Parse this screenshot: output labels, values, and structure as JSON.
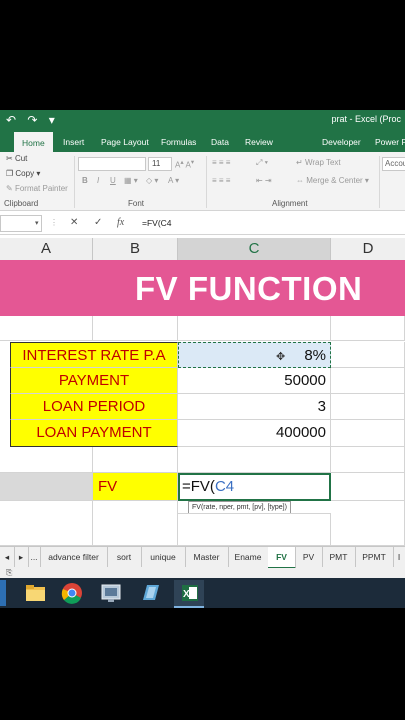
{
  "titlebar": {
    "quick_access": "↶ ↷ ▾",
    "window_title": "prat - Excel (Proc"
  },
  "tabs": [
    {
      "label": "Home",
      "active": true
    },
    {
      "label": "Insert"
    },
    {
      "label": "Page Layout"
    },
    {
      "label": "Formulas"
    },
    {
      "label": "Data"
    },
    {
      "label": "Review"
    },
    {
      "label": "Developer"
    },
    {
      "label": "Power Pi"
    }
  ],
  "ribbon": {
    "cut": "Cut",
    "copy": "Copy",
    "format_painter": "Format Painter",
    "clipboard_group": "Clipboard",
    "font_size": "11",
    "bold": "B",
    "italic": "I",
    "underline": "U",
    "font_group": "Font",
    "wrap_text": "Wrap Text",
    "merge_center": "Merge & Center",
    "alignment_group": "Alignment",
    "number_format": "Accou"
  },
  "formula_bar": {
    "cancel": "✕",
    "enter": "✓",
    "fx": "fx",
    "formula": "=FV(C4"
  },
  "columns": [
    "A",
    "B",
    "C",
    "D"
  ],
  "sheet": {
    "banner": "FV FUNCTION",
    "rows": [
      {
        "label": "INTEREST RATE P.A",
        "value": "8%"
      },
      {
        "label": "PAYMENT",
        "value": "50000"
      },
      {
        "label": "LOAN PERIOD",
        "value": "3"
      },
      {
        "label": "LOAN PAYMENT",
        "value": "400000"
      }
    ],
    "fv_label": "FV",
    "fv_formula_prefix": "=FV(",
    "fv_formula_ref": "C4",
    "tooltip": "FV(rate, nper, pmt, [pv], [type])"
  },
  "sheet_tabs": {
    "ellipsis": "...",
    "tabs": [
      "advance filter",
      "sort",
      "unique",
      "Master",
      "Ename",
      "FV",
      "PV",
      "PMT",
      "PPMT",
      "I"
    ],
    "active": "FV"
  },
  "colors": {
    "excel_green": "#217346",
    "banner_pink": "#e45794",
    "label_yellow": "#ffff00",
    "label_text_red": "#c00000"
  }
}
